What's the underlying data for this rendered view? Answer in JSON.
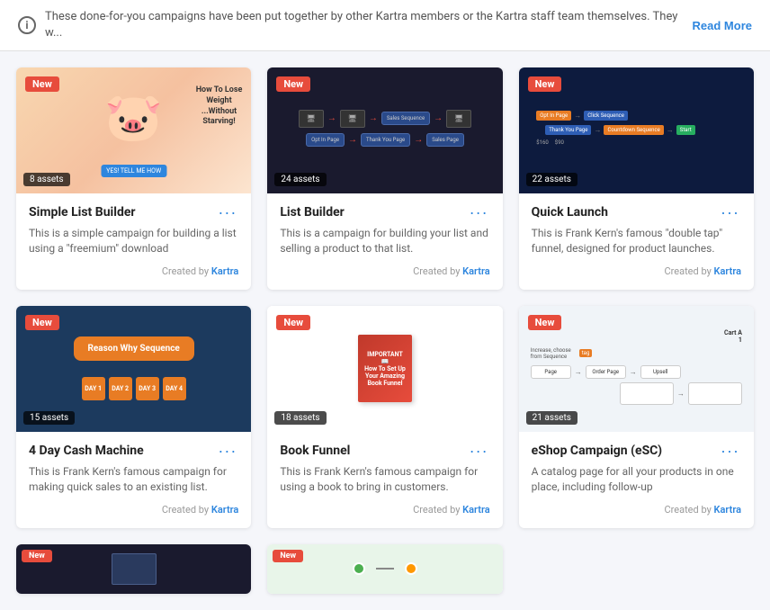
{
  "infoBar": {
    "text": "These done-for-you campaigns have been put together by other Kartra members or the Kartra staff team themselves. They w...",
    "readMoreLabel": "Read More"
  },
  "campaigns": [
    {
      "id": 1,
      "isNew": true,
      "assetCount": "8 assets",
      "title": "Simple List Builder",
      "description": "This is a simple campaign for building a list using a \"freemium\" download",
      "createdBy": "Kartra",
      "createdByLabel": "Created by",
      "imageType": "pig"
    },
    {
      "id": 2,
      "isNew": true,
      "assetCount": "24 assets",
      "title": "List Builder",
      "description": "This is a campaign for building your list and selling a product to that list.",
      "createdBy": "Kartra",
      "createdByLabel": "Created by",
      "imageType": "flow-dark"
    },
    {
      "id": 3,
      "isNew": true,
      "assetCount": "22 assets",
      "title": "Quick Launch",
      "description": "This is Frank Kern's famous \"double tap\" funnel, designed for product launches.",
      "createdBy": "Kartra",
      "createdByLabel": "Created by",
      "imageType": "funnel-dark"
    },
    {
      "id": 4,
      "isNew": true,
      "assetCount": "15 assets",
      "title": "4 Day Cash Machine",
      "description": "This is Frank Kern's famous campaign for making quick sales to an existing list.",
      "createdBy": "Kartra",
      "createdByLabel": "Created by",
      "imageType": "reason-why"
    },
    {
      "id": 5,
      "isNew": true,
      "assetCount": "18 assets",
      "title": "Book Funnel",
      "description": "This is Frank Kern's famous campaign for using a book to bring in customers.",
      "createdBy": "Kartra",
      "createdByLabel": "Created by",
      "imageType": "book"
    },
    {
      "id": 6,
      "isNew": true,
      "assetCount": "21 assets",
      "title": "eShop Campaign (eSC)",
      "description": "A catalog page for all your products in one place, including follow-up",
      "createdBy": "Kartra",
      "createdByLabel": "Created by",
      "imageType": "eshop"
    }
  ],
  "partialCards": [
    {
      "id": 7,
      "isNew": true,
      "imageType": "dark-screen"
    },
    {
      "id": 8,
      "isNew": true,
      "imageType": "green-nodes"
    }
  ],
  "badgeColors": {
    "new": "#e74c3c",
    "kartraLink": "#2e86de"
  }
}
